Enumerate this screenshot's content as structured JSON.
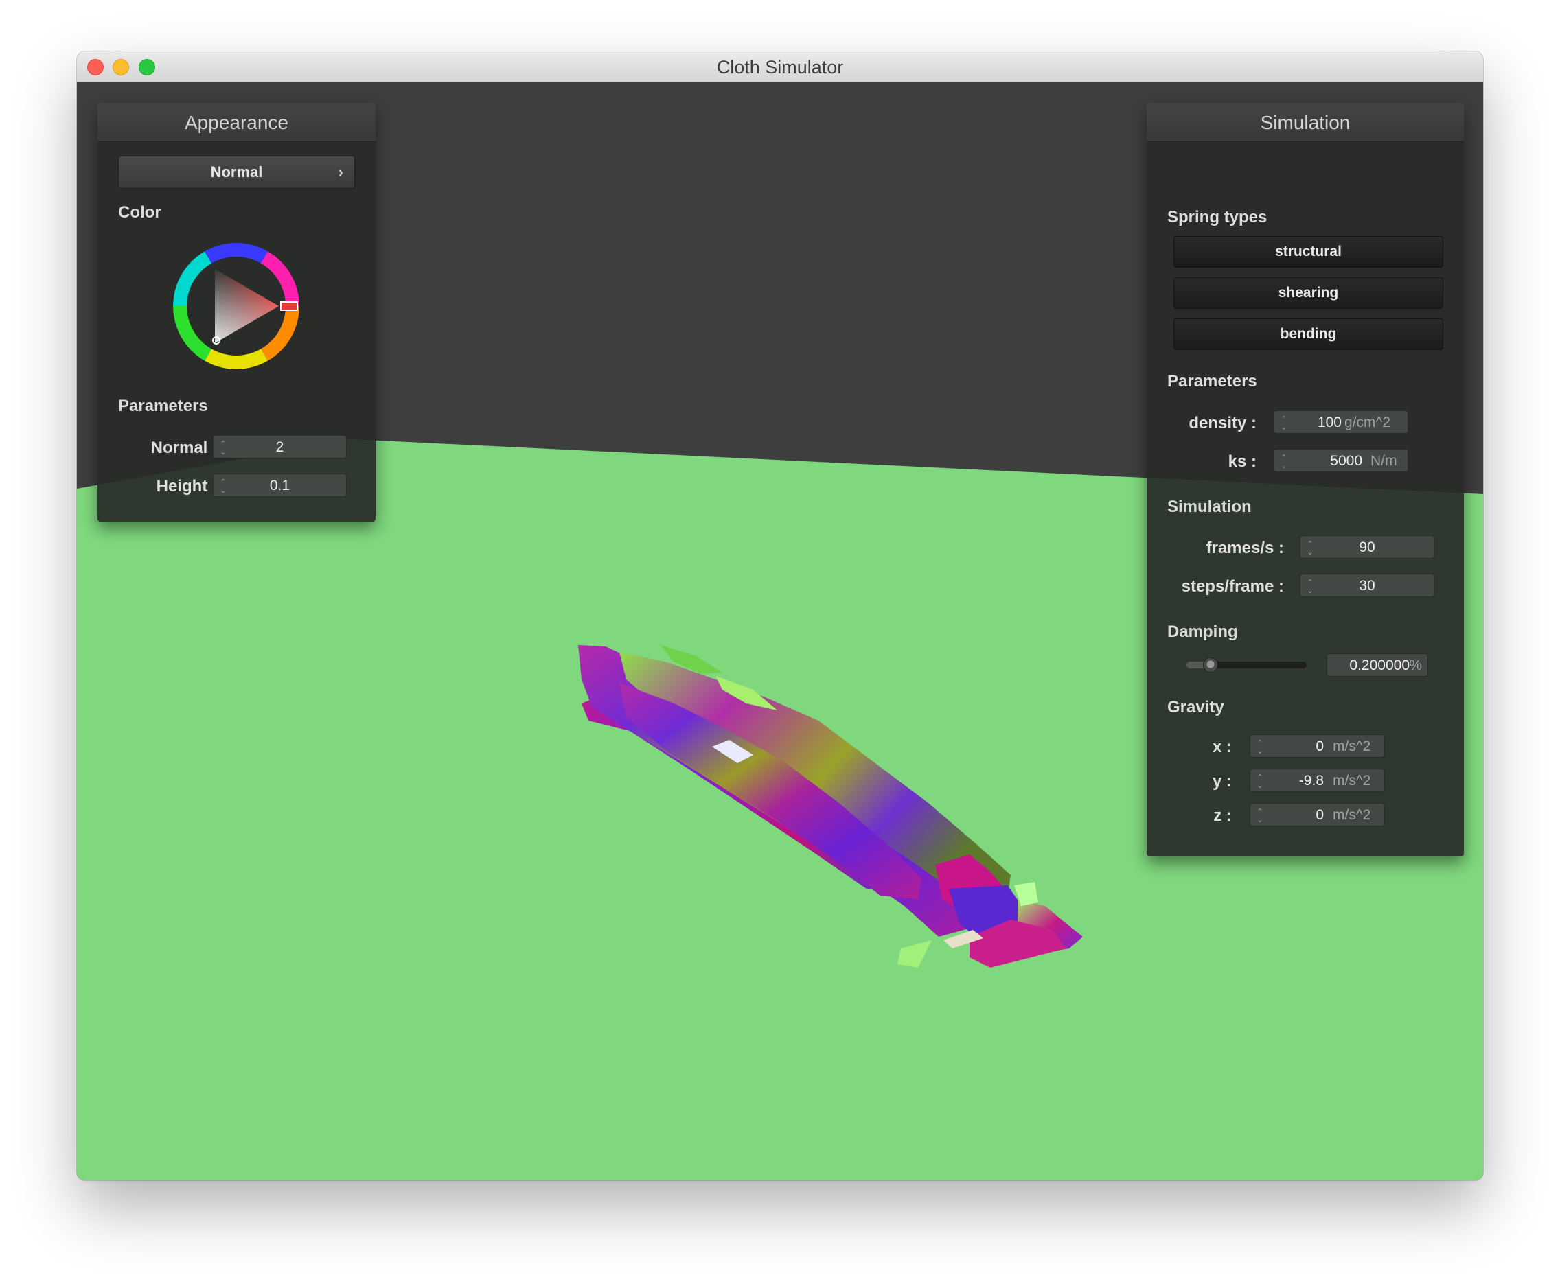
{
  "window": {
    "title": "Cloth Simulator"
  },
  "colors": {
    "ground": "#7fd87e",
    "background": "#3e3e3e",
    "panel": "#2b2d2b",
    "color_wheel_selected": "#e53935"
  },
  "appearance": {
    "header": "Appearance",
    "shader_dropdown": {
      "value": "Normal",
      "chevron": "›"
    },
    "color_label": "Color",
    "parameters_label": "Parameters",
    "params": [
      {
        "label": "Normal :",
        "value": "2"
      },
      {
        "label": "Height :",
        "value": "0.1"
      }
    ]
  },
  "simulation": {
    "header": "Simulation",
    "spring_types_label": "Spring types",
    "spring_types": [
      "structural",
      "shearing",
      "bending"
    ],
    "parameters_label": "Parameters",
    "density": {
      "label": "density :",
      "value": "100",
      "unit": "g/cm^2"
    },
    "ks": {
      "label": "ks :",
      "value": "5000",
      "unit": "N/m"
    },
    "simulation_label": "Simulation",
    "frames": {
      "label": "frames/s :",
      "value": "90"
    },
    "steps": {
      "label": "steps/frame :",
      "value": "30"
    },
    "damping_label": "Damping",
    "damping": {
      "value": "0.200000",
      "unit": "%",
      "slider_fraction": 0.2
    },
    "gravity_label": "Gravity",
    "gravity": [
      {
        "label": "x :",
        "value": "0",
        "unit": "m/s^2"
      },
      {
        "label": "y :",
        "value": "-9.8",
        "unit": "m/s^2"
      },
      {
        "label": "z :",
        "value": "0",
        "unit": "m/s^2"
      }
    ]
  }
}
